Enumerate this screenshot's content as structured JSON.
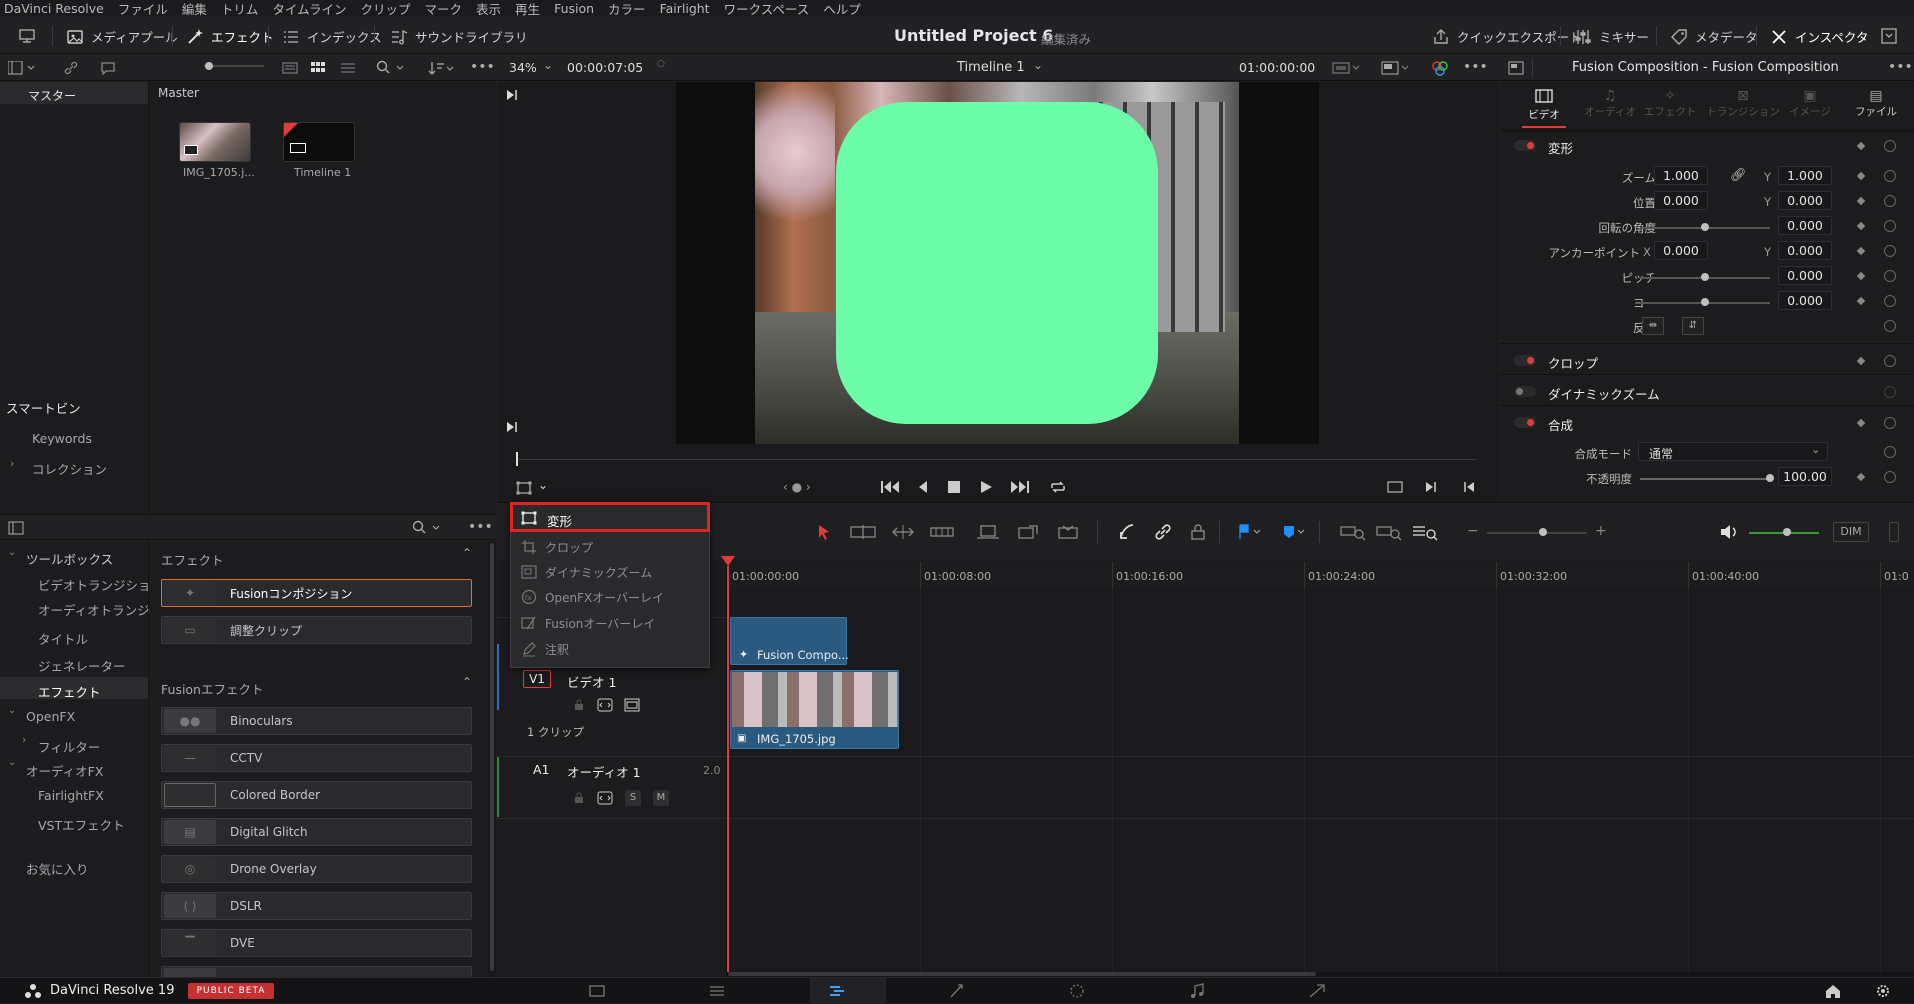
{
  "menu": [
    "DaVinci Resolve",
    "ファイル",
    "編集",
    "トリム",
    "タイムライン",
    "クリップ",
    "マーク",
    "表示",
    "再生",
    "Fusion",
    "カラー",
    "Fairlight",
    "ワークスペース",
    "ヘルプ"
  ],
  "toolbar": {
    "media_pool": "メディアプール",
    "effects": "エフェクト",
    "index": "インデックス",
    "sound_library": "サウンドライブラリ",
    "project_title": "Untitled Project 6",
    "project_status": "編集済み",
    "quick_export": "クイックエクスポート",
    "mixer": "ミキサー",
    "metadata": "メタデータ",
    "inspector": "インスペクタ"
  },
  "viewer_strip": {
    "zoom": "34%",
    "timecode_left": "00:00:07:05",
    "timeline_name": "Timeline 1",
    "timecode_right": "01:00:00:00"
  },
  "media_pool": {
    "master": "マスター",
    "bin_title": "Master",
    "clips": [
      {
        "name": "IMG_1705.j..."
      },
      {
        "name": "Timeline 1"
      }
    ],
    "smart_bins": "スマートビン",
    "keywords": "Keywords",
    "collections": "コレクション"
  },
  "effects_tree": {
    "toolbox": "ツールボックス",
    "items": [
      "ビデオトランジション",
      "オーディオトランジシ...",
      "タイトル",
      "ジェネレーター",
      "エフェクト"
    ],
    "openfx": "OpenFX",
    "filters": "フィルター",
    "audiofx": "オーディオFX",
    "fairlightfx": "FairlightFX",
    "vstfx": "VSTエフェクト",
    "favorites": "お気に入り"
  },
  "effects_list": {
    "section1": "エフェクト",
    "items1": [
      "Fusionコンポジション",
      "調整クリップ"
    ],
    "section2": "Fusionエフェクト",
    "items2": [
      "Binoculars",
      "CCTV",
      "Colored Border",
      "Digital Glitch",
      "Drone Overlay",
      "DSLR",
      "DVE"
    ]
  },
  "overlay_menu": {
    "items": [
      "変形",
      "クロップ",
      "ダイナミックズーム",
      "OpenFXオーバーレイ",
      "Fusionオーバーレイ",
      "注釈"
    ]
  },
  "inspector": {
    "header": "Fusion Composition - Fusion Composition",
    "tabs": [
      "ビデオ",
      "オーディオ",
      "エフェクト",
      "トランジション",
      "イメージ",
      "ファイル"
    ],
    "transform": "変形",
    "zoom": "ズーム",
    "position": "位置",
    "rotation": "回転の角度",
    "anchor": "アンカーポイント",
    "pitch": "ピッチ",
    "yaw": "ヨー",
    "flip": "反転",
    "x": "X",
    "y": "Y",
    "zoom_x": "1.000",
    "zoom_y": "1.000",
    "pos_x": "0.000",
    "pos_y": "0.000",
    "rot": "0.000",
    "anchor_x": "0.000",
    "anchor_y": "0.000",
    "pitch_v": "0.000",
    "yaw_v": "0.000",
    "crop": "クロップ",
    "dynamic_zoom": "ダイナミックズーム",
    "composite": "合成",
    "composite_mode": "合成モード",
    "composite_mode_value": "通常",
    "opacity": "不透明度",
    "opacity_value": "100.00"
  },
  "timeline": {
    "timecodes": [
      "01:00:00:00",
      "01:00:08:00",
      "01:00:16:00",
      "01:00:24:00",
      "01:00:32:00",
      "01:00:40:00",
      "01:0"
    ],
    "v1": "V1",
    "v1_name": "ビデオ 1",
    "v1_clips": "1 クリップ",
    "a1": "A1",
    "a1_name": "オーディオ 1",
    "a1_ch": "2.0",
    "fusion_clip": "Fusion Compo...",
    "image_clip": "IMG_1705.jpg",
    "dim": "DIM",
    "s_btn": "S",
    "m_btn": "M"
  },
  "footer": {
    "app": "DaVinci Resolve 19",
    "badge": "PUBLIC BETA"
  },
  "colors": {
    "accent_red": "#e02424",
    "green_shape": "#6dfca8",
    "clip_blue": "#2b5a80",
    "highlight_orange": "#e2702a"
  }
}
